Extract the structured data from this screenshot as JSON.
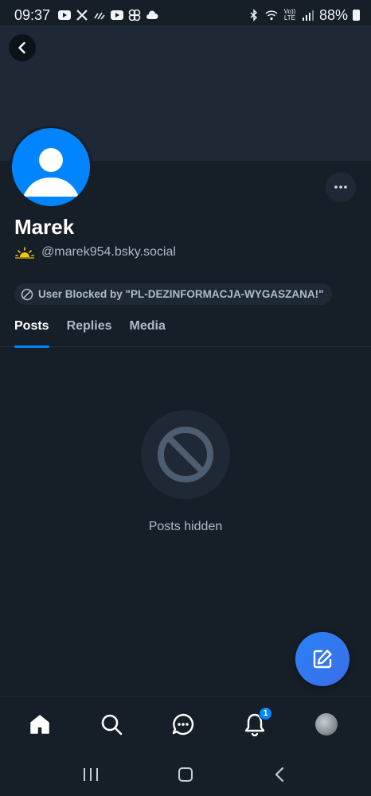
{
  "status_bar": {
    "time": "09:37",
    "battery": "88%",
    "left_icons": [
      "youtube-icon",
      "x-icon",
      "wavy-icon",
      "youtube-icon",
      "pinwheel-icon",
      "cloud-icon"
    ],
    "right_icons": [
      "bluetooth-icon",
      "wifi-icon",
      "volte-icon",
      "signal-icon",
      "battery-icon"
    ],
    "volte_label": "Vo)) LTE"
  },
  "profile": {
    "display_name": "Marek",
    "handle": "@marek954.bsky.social",
    "handle_emoji": "sunrise-icon",
    "blocked_label": "User Blocked by \"PL-DEZINFORMACJA-WYGASZANA!\""
  },
  "tabs": [
    {
      "label": "Posts",
      "active": true
    },
    {
      "label": "Replies",
      "active": false
    },
    {
      "label": "Media",
      "active": false
    }
  ],
  "empty_state": {
    "icon": "blocked-icon",
    "text": "Posts hidden"
  },
  "bottom_nav": {
    "items": [
      "home-icon",
      "search-icon",
      "chat-icon",
      "bell-icon",
      "profile-avatar"
    ],
    "notification_count": "1"
  },
  "colors": {
    "background": "#161e27",
    "banner": "#1e2935",
    "accent": "#0085ff",
    "muted_text": "#aebbc9"
  }
}
